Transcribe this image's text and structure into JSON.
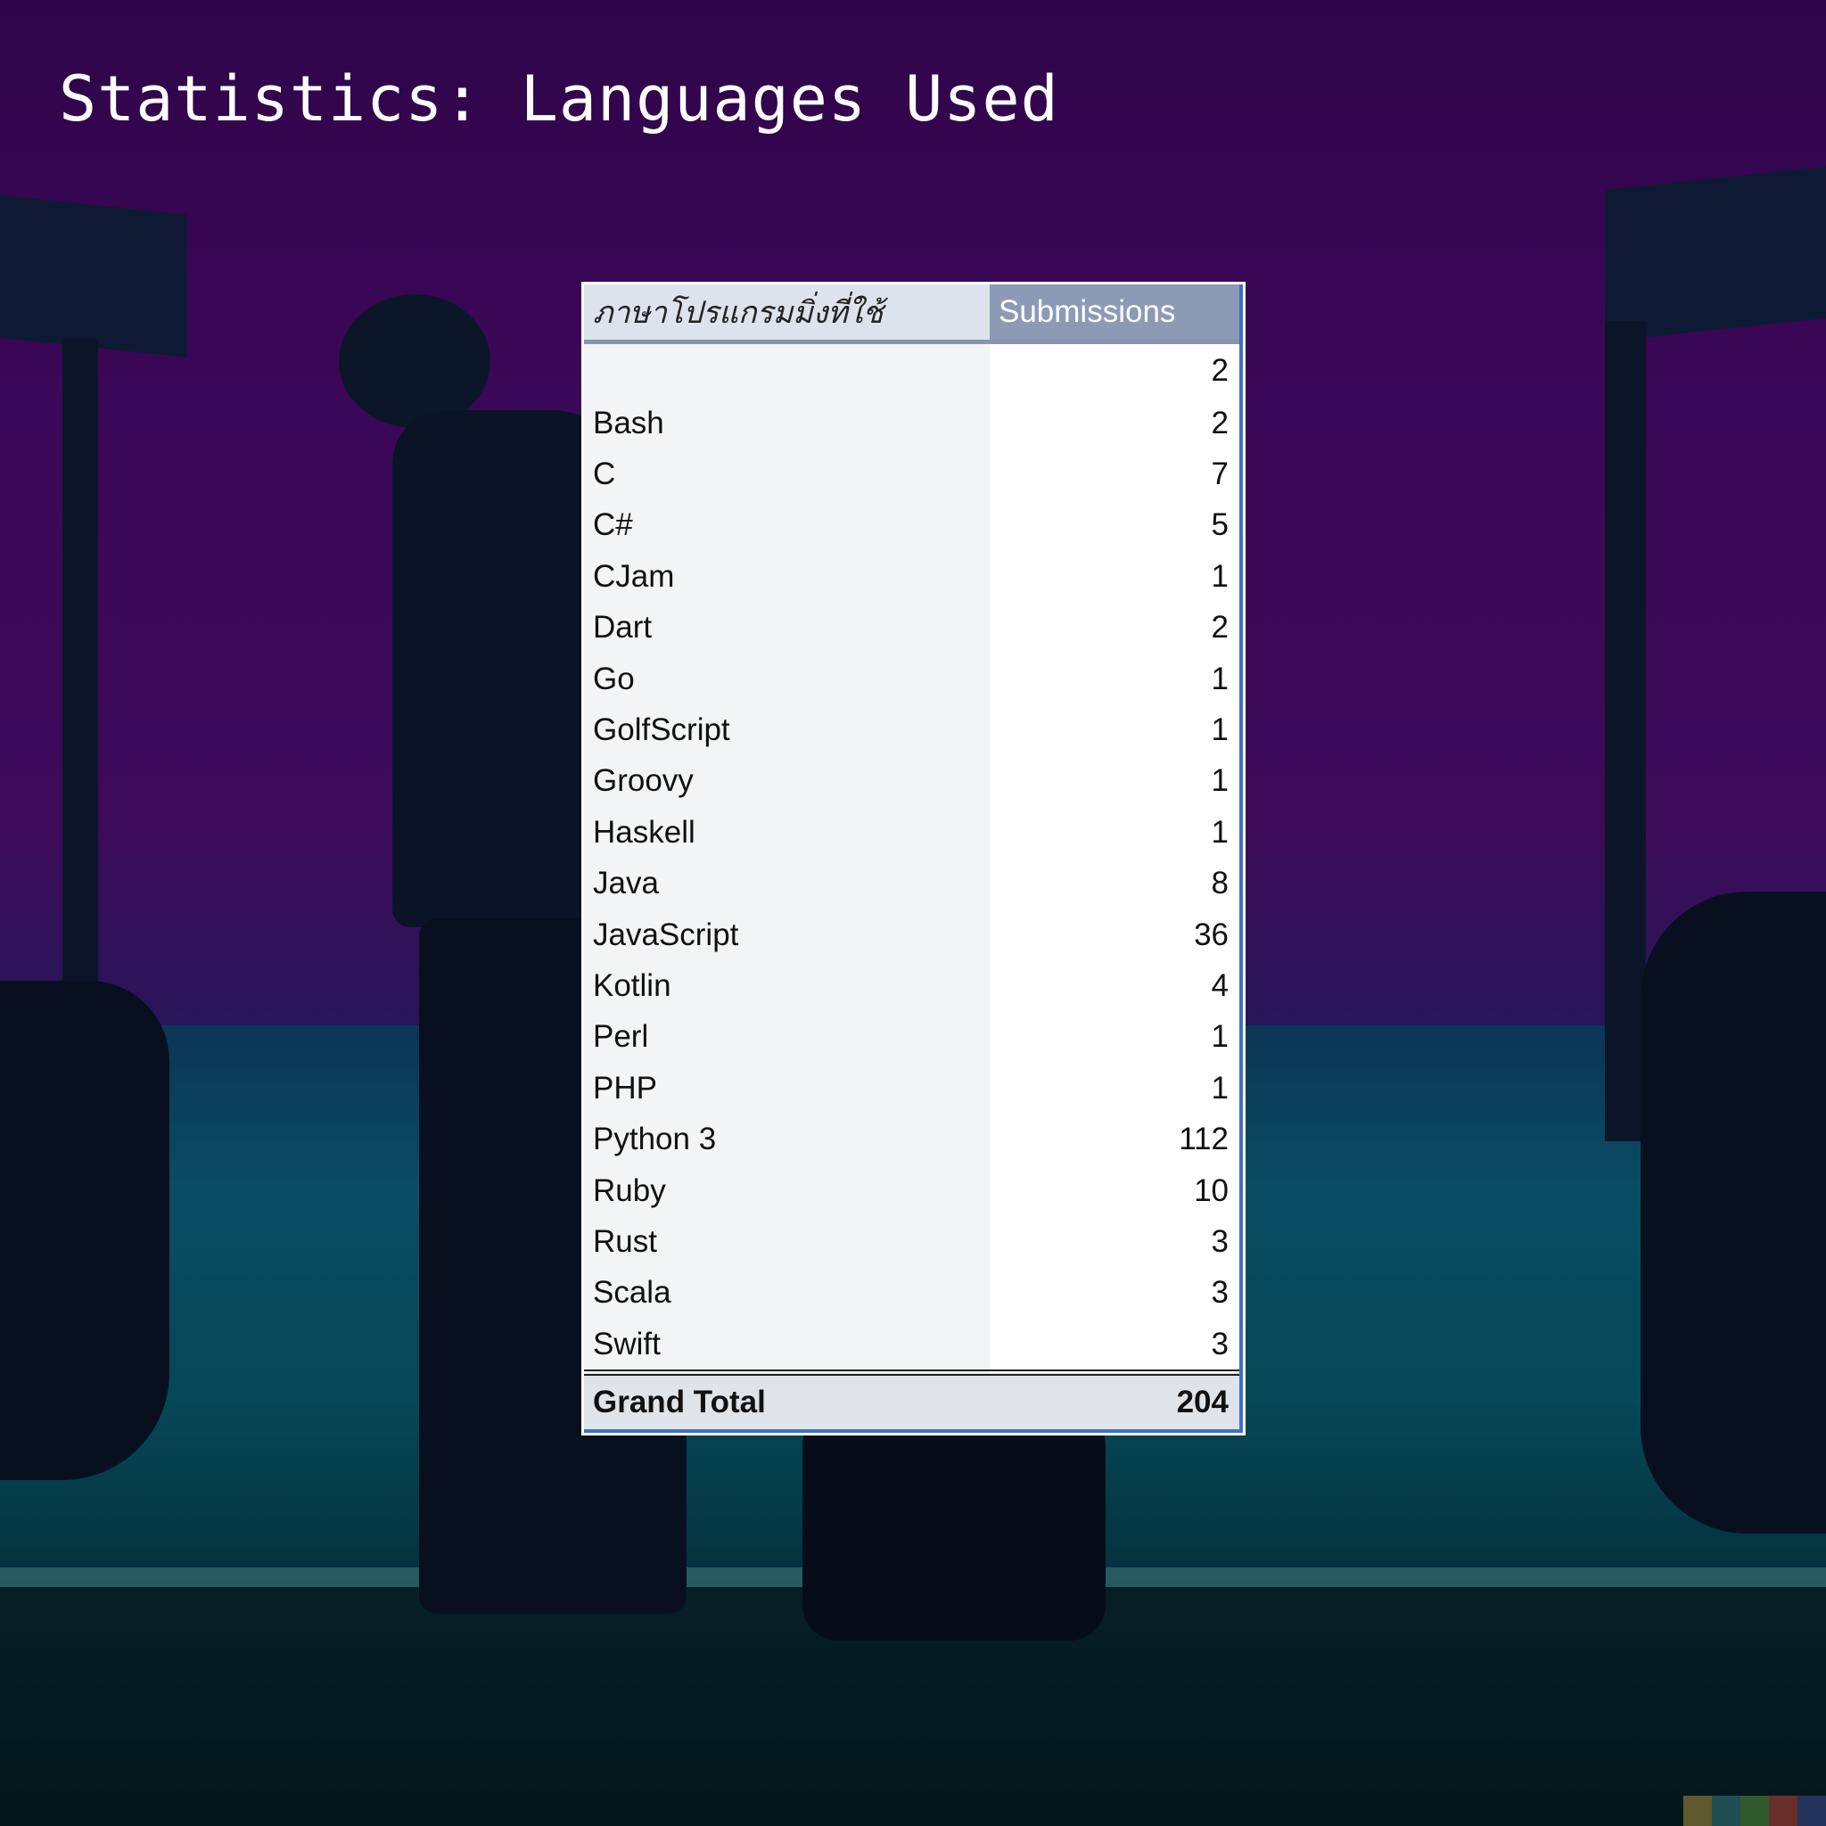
{
  "title": "Statistics: Languages Used",
  "table": {
    "header_language": "ภาษาโปรแกรมมิ่งที่ใช้",
    "header_submissions": "Submissions",
    "rows": [
      {
        "language": "",
        "submissions": "2"
      },
      {
        "language": "Bash",
        "submissions": "2"
      },
      {
        "language": "C",
        "submissions": "7"
      },
      {
        "language": "C#",
        "submissions": "5"
      },
      {
        "language": "CJam",
        "submissions": "1"
      },
      {
        "language": "Dart",
        "submissions": "2"
      },
      {
        "language": "Go",
        "submissions": "1"
      },
      {
        "language": "GolfScript",
        "submissions": "1"
      },
      {
        "language": "Groovy",
        "submissions": "1"
      },
      {
        "language": "Haskell",
        "submissions": "1"
      },
      {
        "language": "Java",
        "submissions": "8"
      },
      {
        "language": "JavaScript",
        "submissions": "36"
      },
      {
        "language": "Kotlin",
        "submissions": "4"
      },
      {
        "language": "Perl",
        "submissions": "1"
      },
      {
        "language": "PHP",
        "submissions": "1"
      },
      {
        "language": "Python 3",
        "submissions": "112"
      },
      {
        "language": "Ruby",
        "submissions": "10"
      },
      {
        "language": "Rust",
        "submissions": "3"
      },
      {
        "language": "Scala",
        "submissions": "3"
      },
      {
        "language": "Swift",
        "submissions": "3"
      }
    ],
    "total_label": "Grand Total",
    "total_value": "204"
  },
  "colors": {
    "header_bg": "#8c9ab5",
    "accent_border": "#3d6fc9",
    "total_bg": "#dfe3ea"
  },
  "corner_swatches": [
    "#5e5a2e",
    "#1f4d52",
    "#2f5a2e",
    "#6a2f2a",
    "#24345c"
  ]
}
